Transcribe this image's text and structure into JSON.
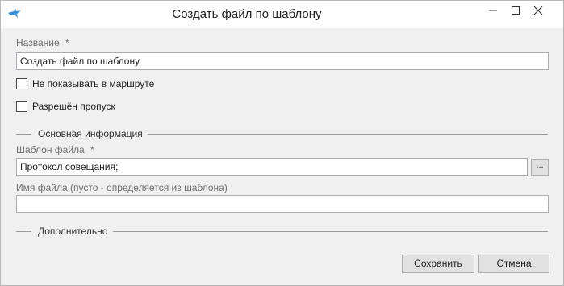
{
  "window": {
    "title": "Создать файл по шаблону"
  },
  "form": {
    "name_label": "Название",
    "required_mark": "*",
    "name_value": "Создать файл по шаблону",
    "hide_in_route_label": "Не показывать в маршруте",
    "hide_in_route_checked": false,
    "allow_skip_label": "Разрешён пропуск",
    "allow_skip_checked": false
  },
  "main_info": {
    "group_title": "Основная информация",
    "template_label": "Шаблон файла",
    "template_value": "Протокол совещания;",
    "browse_label": "...",
    "filename_label": "Имя файла (пусто - определяется из шаблона)",
    "filename_value": ""
  },
  "additional": {
    "group_title": "Дополнительно"
  },
  "buttons": {
    "save_label": "Сохранить",
    "cancel_label": "Отмена"
  },
  "icons": {
    "app": "bird-icon",
    "minimize": "minimize-icon",
    "maximize": "maximize-icon",
    "close": "close-icon"
  },
  "colors": {
    "app_icon": "#3a8fd8",
    "window_bg": "#f0f0f0",
    "titlebar_bg": "#ffffff"
  }
}
